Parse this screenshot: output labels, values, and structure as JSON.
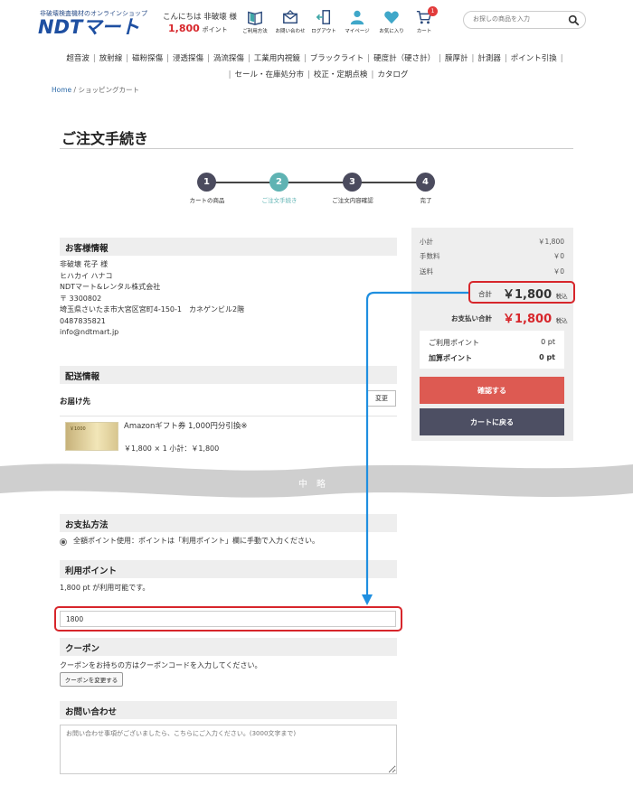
{
  "header": {
    "logo_tagline": "非破壊検査機材のオンラインショップ",
    "logo_text": "NDTマート",
    "greeting": "こんにちは 非破壊 様",
    "points_value": "1,800",
    "points_unit": "ポイント",
    "icons": [
      {
        "label": "ご利用方法",
        "icon": "book-icon"
      },
      {
        "label": "お問い合わせ",
        "icon": "envelope-icon"
      },
      {
        "label": "ログアウト",
        "icon": "logout-icon"
      },
      {
        "label": "マイページ",
        "icon": "user-icon"
      },
      {
        "label": "お気に入り",
        "icon": "heart-icon"
      },
      {
        "label": "カート",
        "icon": "cart-icon",
        "badge": "1"
      }
    ],
    "search_placeholder": "お探しの商品を入力"
  },
  "nav": {
    "row1": [
      "超音波",
      "放射線",
      "磁粉探傷",
      "浸透探傷",
      "渦流探傷",
      "工業用内視鏡",
      "ブラックライト",
      "硬度計（硬さ計）",
      "膜厚計",
      "計測器",
      "ポイント引換"
    ],
    "row2": [
      "セール・在庫処分市",
      "校正・定期点検",
      "カタログ"
    ]
  },
  "breadcrumb": {
    "home": "Home",
    "current": "ショッピングカート"
  },
  "page_title": "ご注文手続き",
  "steps": [
    {
      "num": "1",
      "label": "カートの商品"
    },
    {
      "num": "2",
      "label": "ご注文手続き"
    },
    {
      "num": "3",
      "label": "ご注文内容確認"
    },
    {
      "num": "4",
      "label": "完了"
    }
  ],
  "customer": {
    "heading": "お客様情報",
    "lines": [
      "非破壊 花子 様",
      "ヒハカイ ハナコ",
      "NDTマート&レンタル株式会社",
      "〒 3300802",
      "埼玉県さいたま市大宮区宮町4-150-1　カネゲンビル2階",
      "0487835821",
      "info@ndtmart.jp"
    ]
  },
  "shipping": {
    "heading": "配送情報",
    "deliver_to": "お届け先",
    "change_label": "変更",
    "product_name": "Amazonギフト券 1,000円分引換※",
    "product_price_line": "￥1,800 × 1  小計：￥1,800",
    "product_img_text": "￥1000"
  },
  "summary": {
    "subtotal_label": "小計",
    "subtotal_value": "￥1,800",
    "fee_label": "手数料",
    "fee_value": "￥0",
    "shipping_label": "送料",
    "shipping_value": "￥0",
    "total_label": "合計",
    "total_value": "￥1,800",
    "tax_label": "税込",
    "payment_label": "お支払い合計",
    "payment_value": "￥1,800",
    "payment_tax": "税込",
    "used_points_label": "ご利用ポイント",
    "used_points_value": "0 pt",
    "earned_points_label": "加算ポイント",
    "earned_points_value": "0 pt",
    "confirm_label": "確認する",
    "back_label": "カートに戻る"
  },
  "omitted_label": "中略",
  "payment": {
    "heading": "お支払方法",
    "option": "全額ポイント使用：ポイントは「利用ポイント」欄に手動で入力ください。"
  },
  "points_section": {
    "heading": "利用ポイント",
    "available": "1,800 pt が利用可能です。",
    "input_value": "1800"
  },
  "coupon": {
    "heading": "クーポン",
    "text": "クーポンをお持ちの方はクーポンコードを入力してください。",
    "button": "クーポンを変更する"
  },
  "inquiry": {
    "heading": "お問い合わせ",
    "placeholder": "お問い合わせ事項がございましたら、こちらにご入力ください。(3000文字まで)"
  },
  "colors": {
    "accent_red": "#d7262b",
    "step_active": "#5fb3b3",
    "step_dark": "#4b4b5e",
    "arrow_blue": "#1f8fe0"
  }
}
